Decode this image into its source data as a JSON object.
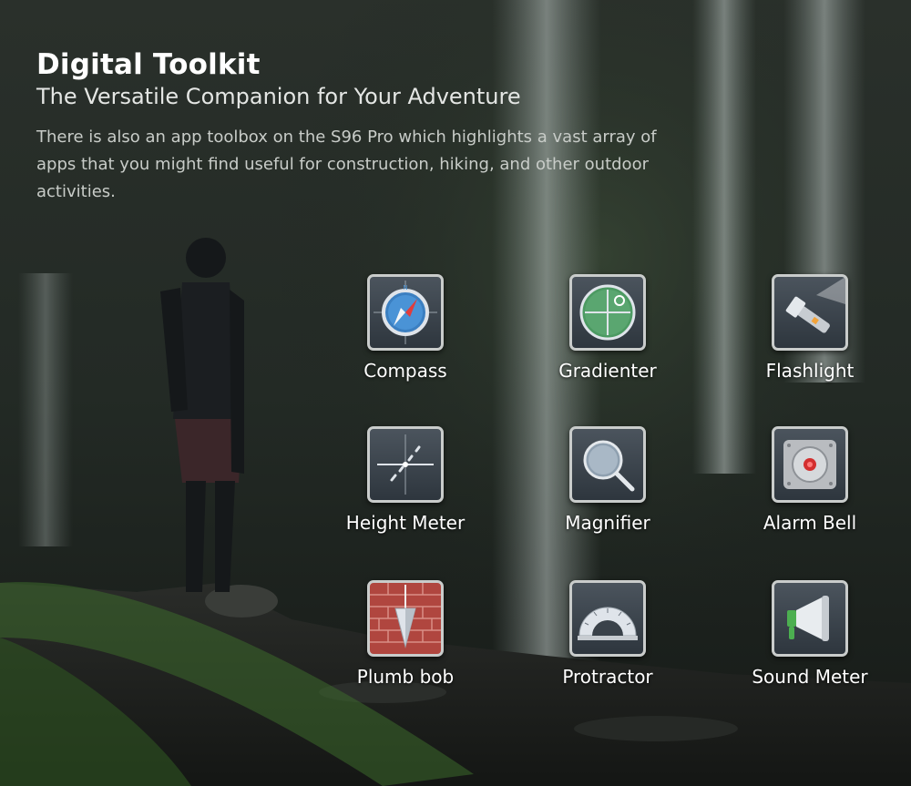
{
  "header": {
    "title": "Digital Toolkit",
    "subtitle": "The Versatile Companion for Your Adventure",
    "description": "There is also an app toolbox on the S96 Pro which highlights a vast array of apps that you might find useful for construction, hiking, and other outdoor activities."
  },
  "apps": [
    {
      "label": "Compass",
      "icon": "compass-icon"
    },
    {
      "label": "Gradienter",
      "icon": "gradienter-icon"
    },
    {
      "label": "Flashlight",
      "icon": "flashlight-icon"
    },
    {
      "label": "Height Meter",
      "icon": "height-meter-icon"
    },
    {
      "label": "Magnifier",
      "icon": "magnifier-icon"
    },
    {
      "label": "Alarm Bell",
      "icon": "alarm-bell-icon"
    },
    {
      "label": "Plumb bob",
      "icon": "plumb-bob-icon"
    },
    {
      "label": "Protractor",
      "icon": "protractor-icon"
    },
    {
      "label": "Sound Meter",
      "icon": "sound-meter-icon"
    }
  ],
  "colors": {
    "tile_border": "#c9cccb",
    "tile_bg": "#3a424a",
    "text": "#ffffff"
  }
}
